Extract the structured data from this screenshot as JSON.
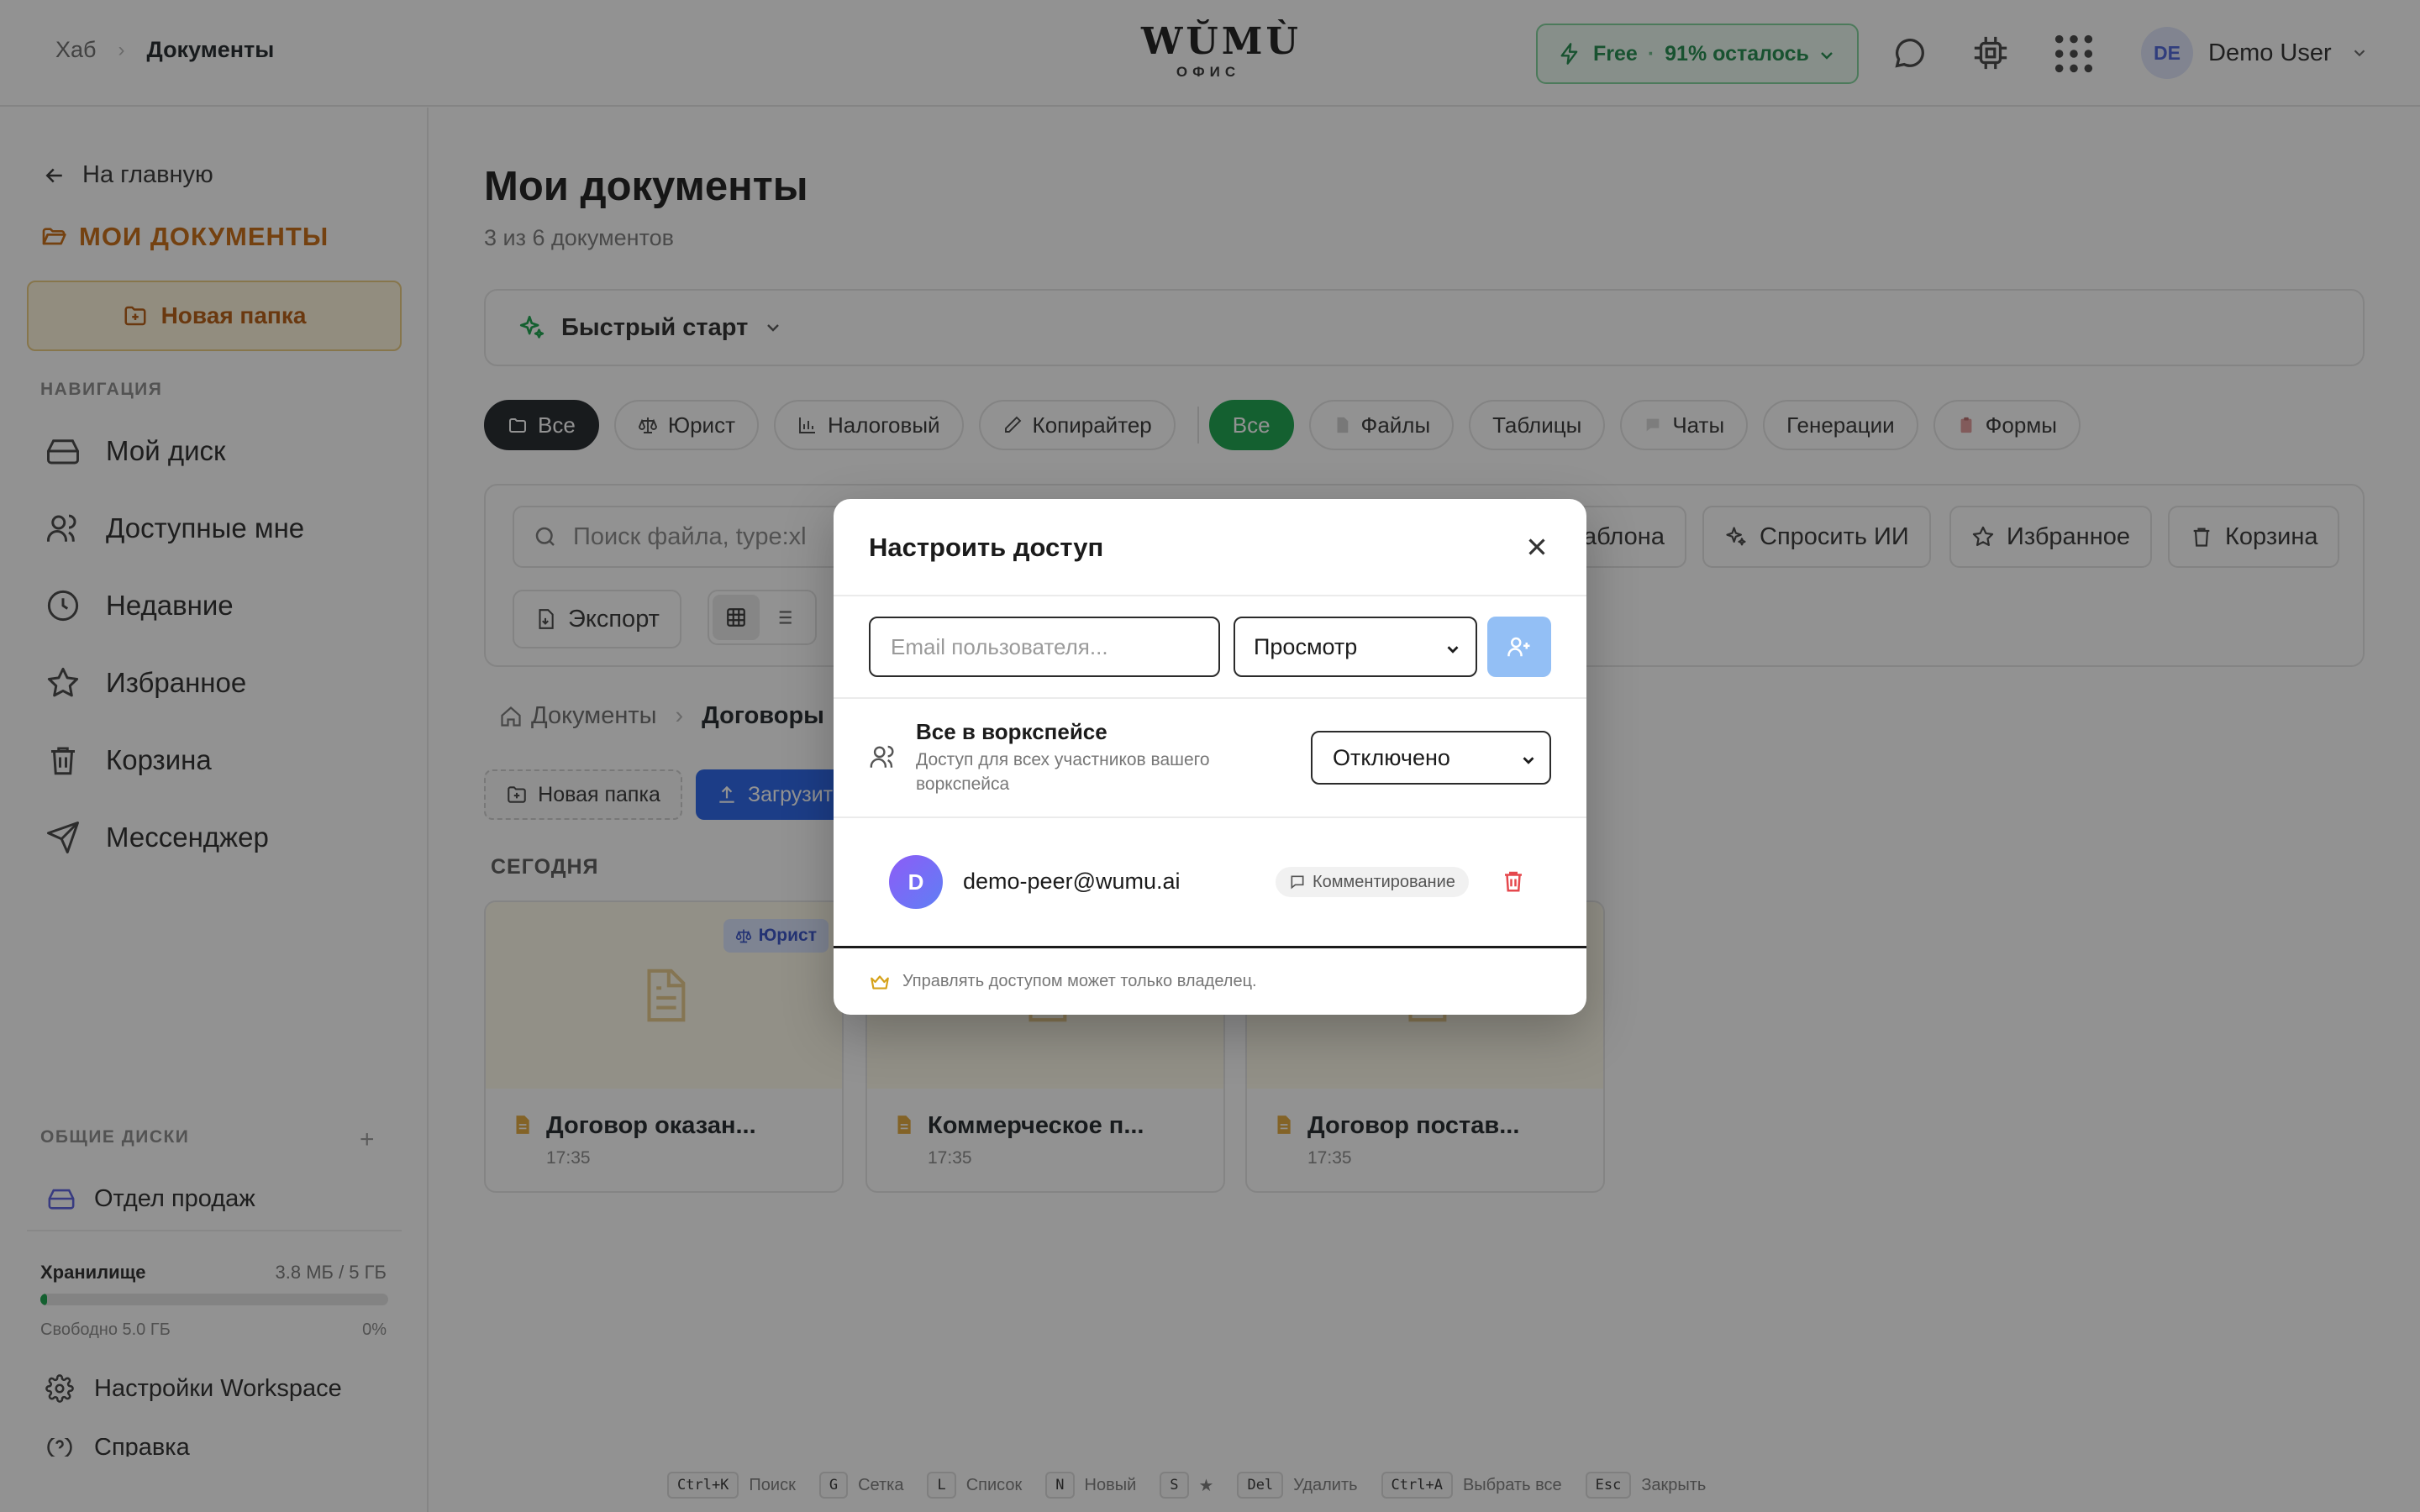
{
  "header": {
    "breadcrumb_root": "Хаб",
    "breadcrumb_sep": "›",
    "breadcrumb_current": "Документы",
    "logo_main": "WŬMÙ",
    "logo_sub": "ОФИС",
    "plan_name": "Free",
    "plan_dot": "·",
    "plan_quota": "91% осталось",
    "user_initials": "DE",
    "user_name": "Demo User",
    "icons": [
      "bolt-icon",
      "chat-icon",
      "chip-icon",
      "apps-grid-icon",
      "chevron-down-icon"
    ]
  },
  "sidebar": {
    "back_label": "На главную",
    "section_title": "МОИ ДОКУМЕНТЫ",
    "new_folder_label": "Новая папка",
    "nav_label": "НАВИГАЦИЯ",
    "nav_items": [
      {
        "label": "Мой диск",
        "icon": "drive-icon"
      },
      {
        "label": "Доступные мне",
        "icon": "users-icon"
      },
      {
        "label": "Недавние",
        "icon": "clock-icon"
      },
      {
        "label": "Избранное",
        "icon": "star-icon"
      },
      {
        "label": "Корзина",
        "icon": "trash-icon"
      },
      {
        "label": "Мессенджер",
        "icon": "send-icon"
      }
    ],
    "shared_label": "ОБЩИЕ ДИСКИ",
    "shared_plus": "+",
    "shared_drive": "Отдел продаж",
    "storage_label": "Хранилище",
    "storage_value": "3.8 МБ / 5 ГБ",
    "storage_fraction": 0.02,
    "storage_free": "Свободно 5.0 ГБ",
    "storage_pct": "0%",
    "settings_label": "Настройки Workspace",
    "help_label": "Справка"
  },
  "main": {
    "title": "Мои документы",
    "subtitle": "3 из 6 документов",
    "quickstart_label": "Быстрый старт",
    "chips": {
      "all_roles": "Все",
      "lawyer": "Юрист",
      "tax": "Налоговый",
      "copywriter": "Копирайтер",
      "all_types": "Все",
      "files": "Файлы",
      "tables": "Таблицы",
      "chats": "Чаты",
      "generations": "Генерации",
      "forms": "Формы"
    },
    "search_placeholder": "Поиск файла, type:xl",
    "template_tail": "аблона",
    "ask_ai": "Спросить ИИ",
    "favorites": "Избранное",
    "trash": "Корзина",
    "export": "Экспорт",
    "path_root": "Документы",
    "path_sep": "›",
    "path_current": "Договоры",
    "new_folder": "Новая папка",
    "upload": "Загрузить",
    "today": "СЕГОДНЯ",
    "cards": [
      {
        "title": "Договор оказан...",
        "time": "17:35",
        "badge": "Юрист"
      },
      {
        "title": "Коммерческое п...",
        "time": "17:35"
      },
      {
        "title": "Договор постав...",
        "time": "17:35"
      }
    ]
  },
  "shortcuts": [
    {
      "key": "Ctrl+K",
      "label": "Поиск"
    },
    {
      "key": "G",
      "label": "Сетка"
    },
    {
      "key": "L",
      "label": "Список"
    },
    {
      "key": "N",
      "label": "Новый"
    },
    {
      "key": "S",
      "label": "★"
    },
    {
      "key": "Del",
      "label": "Удалить"
    },
    {
      "key": "Ctrl+A",
      "label": "Выбрать все"
    },
    {
      "key": "Esc",
      "label": "Закрыть"
    }
  ],
  "modal": {
    "title": "Настроить доступ",
    "email_placeholder": "Email пользователя...",
    "role_value": "Просмотр",
    "workspace_title": "Все в воркспейсе",
    "workspace_desc": "Доступ для всех участников вашего воркспейса",
    "workspace_value": "Отключено",
    "peer_initial": "D",
    "peer_email": "demo-peer@wumu.ai",
    "peer_role": "Комментирование",
    "footer_note": "Управлять доступом может только владелец."
  },
  "colors": {
    "accent_green": "#17a34a",
    "accent_orange": "#c86a10",
    "accent_blue": "#2563eb",
    "danger_red": "#e5484d"
  }
}
